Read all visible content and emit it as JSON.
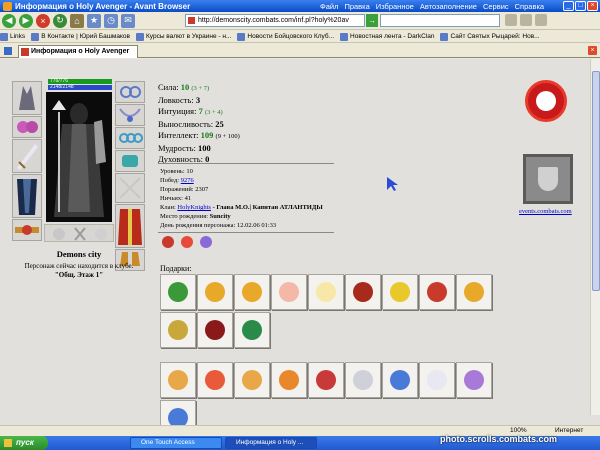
{
  "window": {
    "title": "Информация о Holy Avenger - Avant Browser",
    "menu": [
      "Файл",
      "Правка",
      "Избранное",
      "Автозаполнение",
      "Сервис",
      "Справка"
    ]
  },
  "toolbar": {
    "address": "http://demonscity.combats.com/inf.pl?holy%20av"
  },
  "links": {
    "label": "Links",
    "items": [
      "В Контакте | Юрий Башмаков",
      "Курсы валют в Украине - н...",
      "Новости Бойцовского Клуб...",
      "Новостная лента - DarkClan",
      "Сайт Святых Рыцарей: Нов..."
    ]
  },
  "tab": {
    "label": "Информация о Holy Avenger"
  },
  "character": {
    "hp": "776/776",
    "mp": "2148/2148",
    "name": "Demons city",
    "location_text": "Персонаж сейчас находится в клубе.",
    "location_place": "\"Общ. Этаж 1\""
  },
  "stats": {
    "strength_label": "Сила:",
    "strength_val": "10",
    "strength_extra": "(3 + 7)",
    "agility_label": "Ловкость:",
    "agility_val": "3",
    "intuition_label": "Интуиция:",
    "intuition_val": "7",
    "intuition_extra": "(3 + 4)",
    "endurance_label": "Выносливость:",
    "endurance_val": "25",
    "intellect_label": "Интеллект:",
    "intellect_val": "109",
    "intellect_extra": "(9 + 100)",
    "wisdom_label": "Мудрость:",
    "wisdom_val": "100",
    "spirit_label": "Духовность:",
    "spirit_val": "0"
  },
  "info": {
    "level_label": "Уровень:",
    "level_val": "10",
    "wins_label": "Побед:",
    "wins_val": "9276",
    "losses_label": "Поражений:",
    "losses_val": "2307",
    "draws_label": "Ничьих:",
    "draws_val": "41",
    "clan_label": "Клан:",
    "clan_name": "HolyKnights",
    "clan_title": "- Глава М.О.| Капитан АТЛАНТИДЫ",
    "birthplace_label": "Место рождения:",
    "birthplace_val": "Suncity",
    "birthday_label": "День рождения персонажа:",
    "birthday_val": "12.02.06 01:33"
  },
  "right": {
    "events_link": "events.combats.com"
  },
  "gifts": {
    "title": "Подарки:"
  },
  "colors": {
    "stat_green": "#1a7a1a",
    "link_blue": "#0000cc",
    "hp": "#1a9a1a",
    "mp": "#2a4ac8"
  },
  "statusbar": {
    "zoom": "100%",
    "zone": "Интернет"
  },
  "taskbar": {
    "start": "пуск",
    "items": [
      "One Touch Access",
      "Информация о Holy ..."
    ],
    "watermark": "photo.scrolls.combats.com"
  }
}
